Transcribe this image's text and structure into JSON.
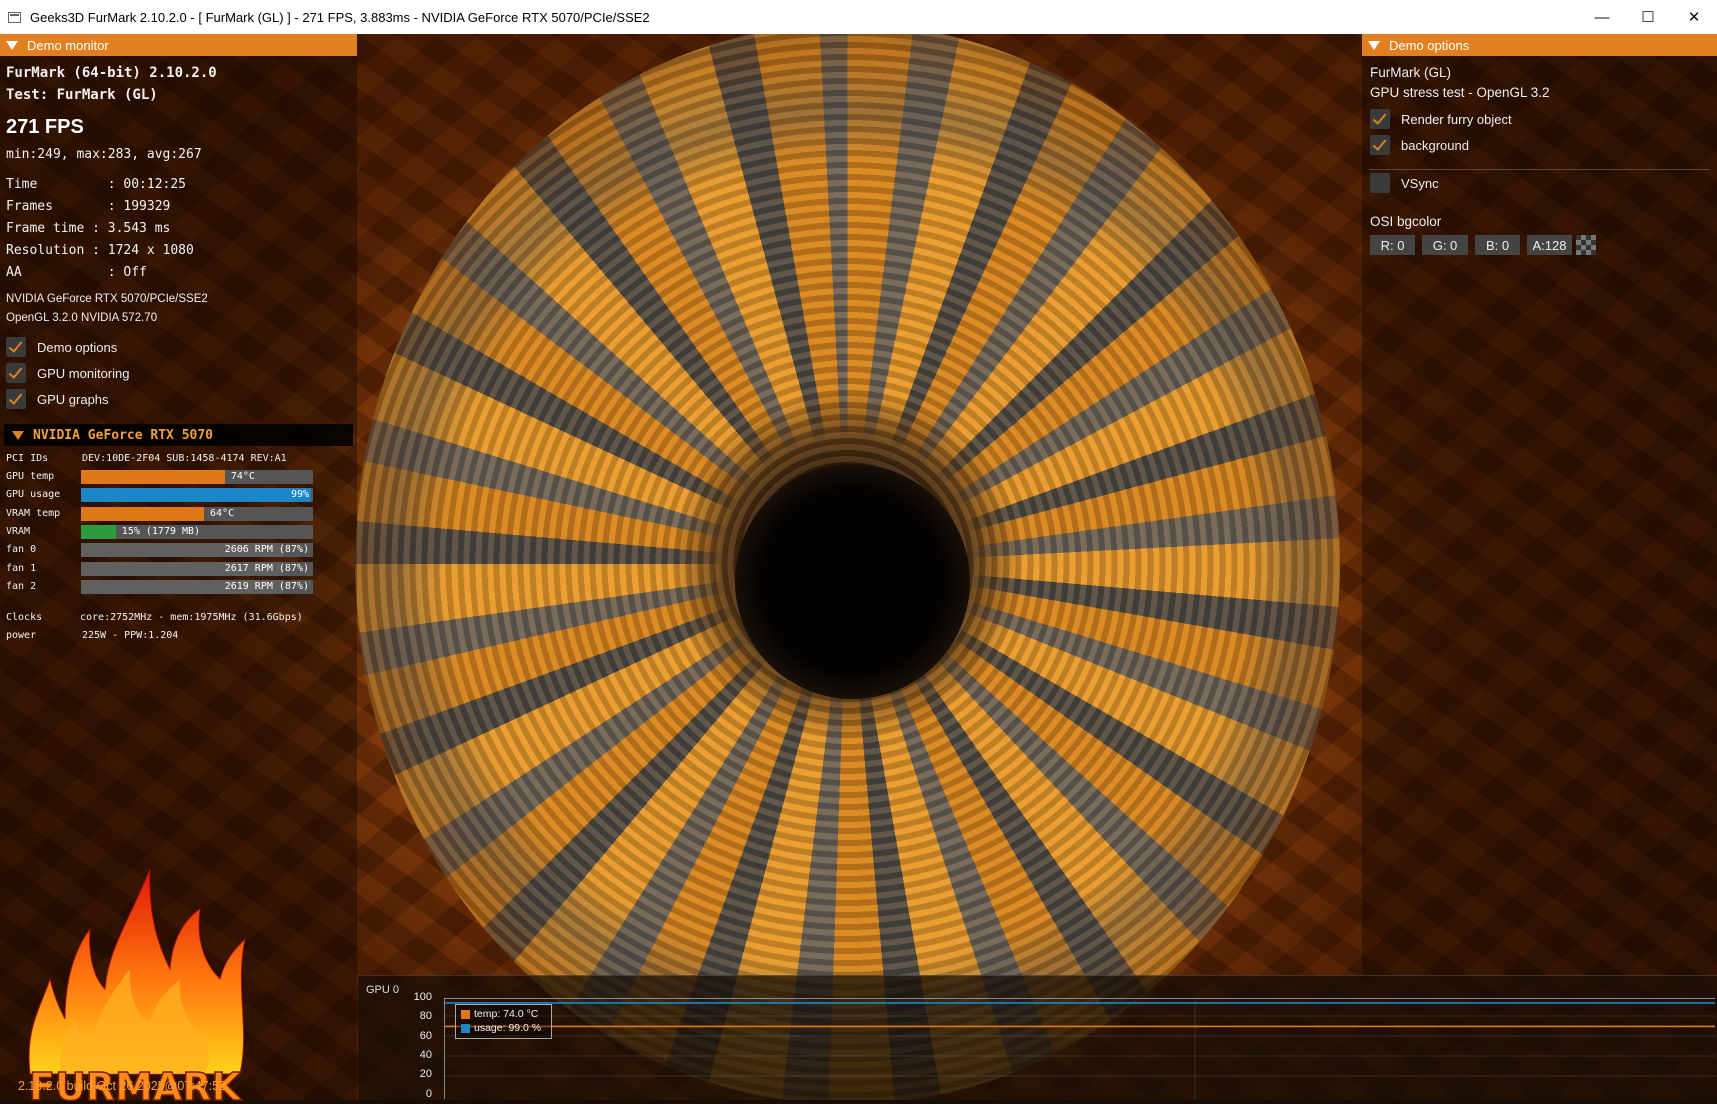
{
  "window": {
    "title": "Geeks3D FurMark 2.10.2.0 - [ FurMark (GL) ] - 271 FPS, 3.883ms - NVIDIA GeForce RTX 5070/PCIe/SSE2",
    "minimize": "—",
    "maximize": "☐",
    "close": "✕"
  },
  "monitor": {
    "header": "Demo monitor",
    "app_line": "FurMark (64-bit) 2.10.2.0",
    "test_line": "Test: FurMark (GL)",
    "fps": "271 FPS",
    "fps_stats": "min:249, max:283, avg:267",
    "time": "Time         : 00:12:25",
    "frames": "Frames       : 199329",
    "frame_time": "Frame time : 3.543 ms",
    "resolution": "Resolution : 1724 x 1080",
    "aa": "AA           : Off",
    "renderer": "NVIDIA GeForce RTX 5070/PCIe/SSE2",
    "gl_version": "OpenGL 3.2.0 NVIDIA 572.70",
    "checkboxes": [
      {
        "label": "Demo options",
        "checked": true
      },
      {
        "label": "GPU monitoring",
        "checked": true
      },
      {
        "label": "GPU graphs",
        "checked": true
      }
    ]
  },
  "gpu": {
    "header": "NVIDIA GeForce RTX 5070",
    "pci_label": "PCI IDs",
    "pci_value": "DEV:10DE-2F04 SUB:1458-4174 REV:A1",
    "rows": [
      {
        "label": "GPU temp",
        "text": "74°C",
        "fill": 0.62,
        "color": "#e07818"
      },
      {
        "label": "GPU usage",
        "text": "99%",
        "fill": 0.99,
        "color": "#1a86c8"
      },
      {
        "label": "VRAM temp",
        "text": "64°C",
        "fill": 0.53,
        "color": "#e07818"
      },
      {
        "label": "VRAM",
        "text": "15% (1779 MB)",
        "fill": 0.15,
        "color": "#2e9a3e"
      },
      {
        "label": "fan 0",
        "text": "2606 RPM (87%)",
        "fill": 0.87,
        "color": "#606060"
      },
      {
        "label": "fan 1",
        "text": "2617 RPM (87%)",
        "fill": 0.87,
        "color": "#606060"
      },
      {
        "label": "fan 2",
        "text": "2619 RPM (87%)",
        "fill": 0.87,
        "color": "#606060"
      }
    ],
    "clocks_label": "Clocks",
    "clocks_value": "core:2752MHz - mem:1975MHz (31.6Gbps)",
    "power_label": "power",
    "power_value": "225W - PPW:1.204"
  },
  "logo_text": "FURMARK",
  "build": "2.10.2.0 build Oct 26 2025@07:47:52",
  "options": {
    "header": "Demo options",
    "demo_name": "FurMark (GL)",
    "demo_desc": "GPU stress test - OpenGL 3.2",
    "checkboxes": [
      {
        "label": "Render furry object",
        "checked": true
      },
      {
        "label": "background",
        "checked": true
      },
      {
        "label": "VSync",
        "checked": false
      }
    ],
    "osi_label": "OSI bgcolor",
    "osi": {
      "r": "R: 0",
      "g": "G: 0",
      "b": "B: 0",
      "a": "A:128"
    }
  },
  "graph": {
    "title": "GPU 0",
    "y_ticks": [
      "100",
      "80",
      "60",
      "40",
      "20",
      "0"
    ],
    "legend": [
      {
        "label": "temp: 74.0 °C",
        "color": "#e07818"
      },
      {
        "label": "usage: 99.0 %",
        "color": "#1a86c8"
      }
    ]
  },
  "chart_data": {
    "type": "line",
    "title": "GPU 0",
    "ylim": [
      0,
      100
    ],
    "series": [
      {
        "name": "temp",
        "value": 74.0,
        "unit": "°C",
        "color": "#e07818"
      },
      {
        "name": "usage",
        "value": 99.0,
        "unit": "%",
        "color": "#1a86c8"
      }
    ]
  },
  "colors": {
    "accent": "#e08020"
  }
}
